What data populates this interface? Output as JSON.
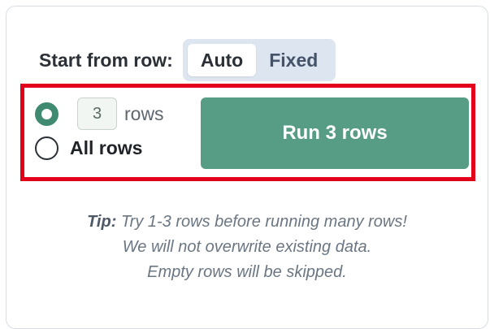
{
  "start_from_row": {
    "label": "Start from row:",
    "options": [
      "Auto",
      "Fixed"
    ],
    "selected": "Auto"
  },
  "run_options": {
    "count_value": "3",
    "count_suffix": "rows",
    "all_rows_label": "All rows",
    "selected_option": "count"
  },
  "run_button": {
    "label": "Run 3 rows"
  },
  "tip": {
    "prefix": "Tip:",
    "line1": "Try 1-3 rows before running many rows!",
    "line2": "We will not overwrite existing data.",
    "line3": "Empty rows will be skipped."
  },
  "colors": {
    "accent_green": "#579c84",
    "highlight_red": "#e3001b",
    "segment_bg": "#dde5f0"
  }
}
